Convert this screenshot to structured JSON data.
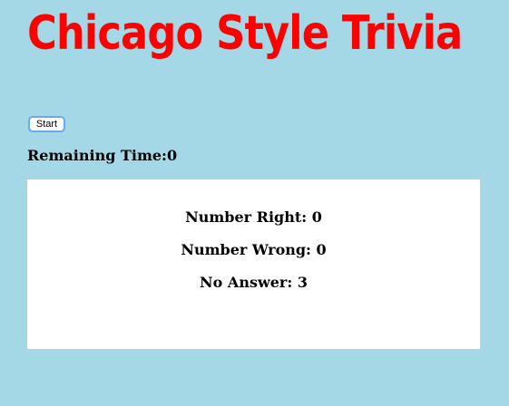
{
  "header": {
    "title": "Chicago Style Trivia"
  },
  "controls": {
    "start_label": "Start"
  },
  "timer": {
    "label": "Remaining Time:",
    "value": "0"
  },
  "results": {
    "right_label": "Number Right: ",
    "right_value": "0",
    "wrong_label": "Number Wrong: ",
    "wrong_value": "0",
    "no_answer_label": "No Answer: ",
    "no_answer_value": "3"
  },
  "colors": {
    "background": "#a5d8e7",
    "title": "#ff0000",
    "panel": "#ffffff"
  }
}
